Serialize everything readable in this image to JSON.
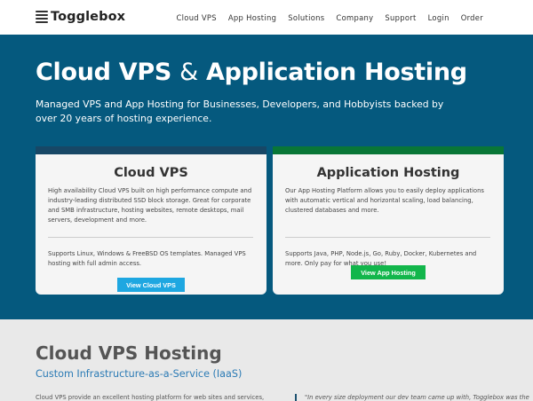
{
  "header": {
    "logo_text": "Togglebox",
    "nav": [
      "Cloud VPS",
      "App Hosting",
      "Solutions",
      "Company",
      "Support",
      "Login",
      "Order"
    ]
  },
  "hero": {
    "title_part1": "Cloud VPS ",
    "title_amp": "&",
    "title_part2": " Application Hosting",
    "subtitle": "Managed VPS and App Hosting for Businesses, Developers, and Hobbyists backed by over 20 years of hosting experience."
  },
  "cards": {
    "cloud": {
      "title": "Cloud VPS",
      "text1": "High availability Cloud VPS built on high performance compute and industry-leading distributed SSD block storage. Great for corporate and SMB infrastructure, hosting websites, remote desktops, mail servers, development and more.",
      "text2": "Supports Linux, Windows & FreeBSD OS templates. Managed VPS hosting with full admin access.",
      "button": "View Cloud VPS"
    },
    "app": {
      "title": "Application Hosting",
      "text1": "Our App Hosting Platform allows you to easily deploy applications with automatic vertical and horizontal scaling, load balancing, clustered databases and more.",
      "text2": "Supports Java, PHP, Node.js, Go, Ruby, Docker, Kubernetes and more. Only pay for what you use!",
      "button": "View App Hosting"
    }
  },
  "section2": {
    "title": "Cloud VPS Hosting",
    "subtitle": "Custom Infrastructure-as-a-Service (IaaS)",
    "text": "Cloud VPS provide an excellent hosting platform for web sites and services,",
    "quote": "\"In every size deployment our dev team came up with, Togglebox was the"
  },
  "colors": {
    "hero_bg": "#05597e",
    "cloud_accent": "#174766",
    "app_accent": "#097637",
    "cloud_button": "#1ea7e1",
    "app_button": "#12b64b",
    "subtitle_link": "#2c7bb5"
  },
  "icons": {
    "logo": "stacked-bars-icon"
  }
}
